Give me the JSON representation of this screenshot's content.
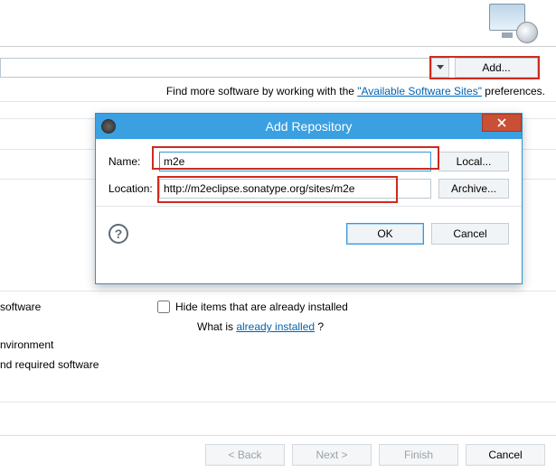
{
  "header": {
    "icon_name": "install-icon"
  },
  "toolbar": {
    "add_label": "Add..."
  },
  "hint": {
    "prefix": "Find more software by working with the ",
    "link": "\"Available Software Sites\"",
    "suffix": " preferences."
  },
  "dialog": {
    "title": "Add Repository",
    "name_label": "Name:",
    "name_value": "m2e",
    "location_label": "Location:",
    "location_value": "http://m2eclipse.sonatype.org/sites/m2e",
    "local_label": "Local...",
    "archive_label": "Archive...",
    "ok_label": "OK",
    "cancel_label": "Cancel",
    "help_glyph": "?"
  },
  "background": {
    "software_label": "software",
    "environment_label": "nvironment",
    "required_label": "nd required software",
    "hide_label": "Hide items that are already installed",
    "whatis_prefix": "What is ",
    "whatis_link": "already installed",
    "whatis_suffix": "?"
  },
  "wizard": {
    "back_label": "< Back",
    "next_label": "Next >",
    "finish_label": "Finish",
    "cancel_label": "Cancel"
  }
}
